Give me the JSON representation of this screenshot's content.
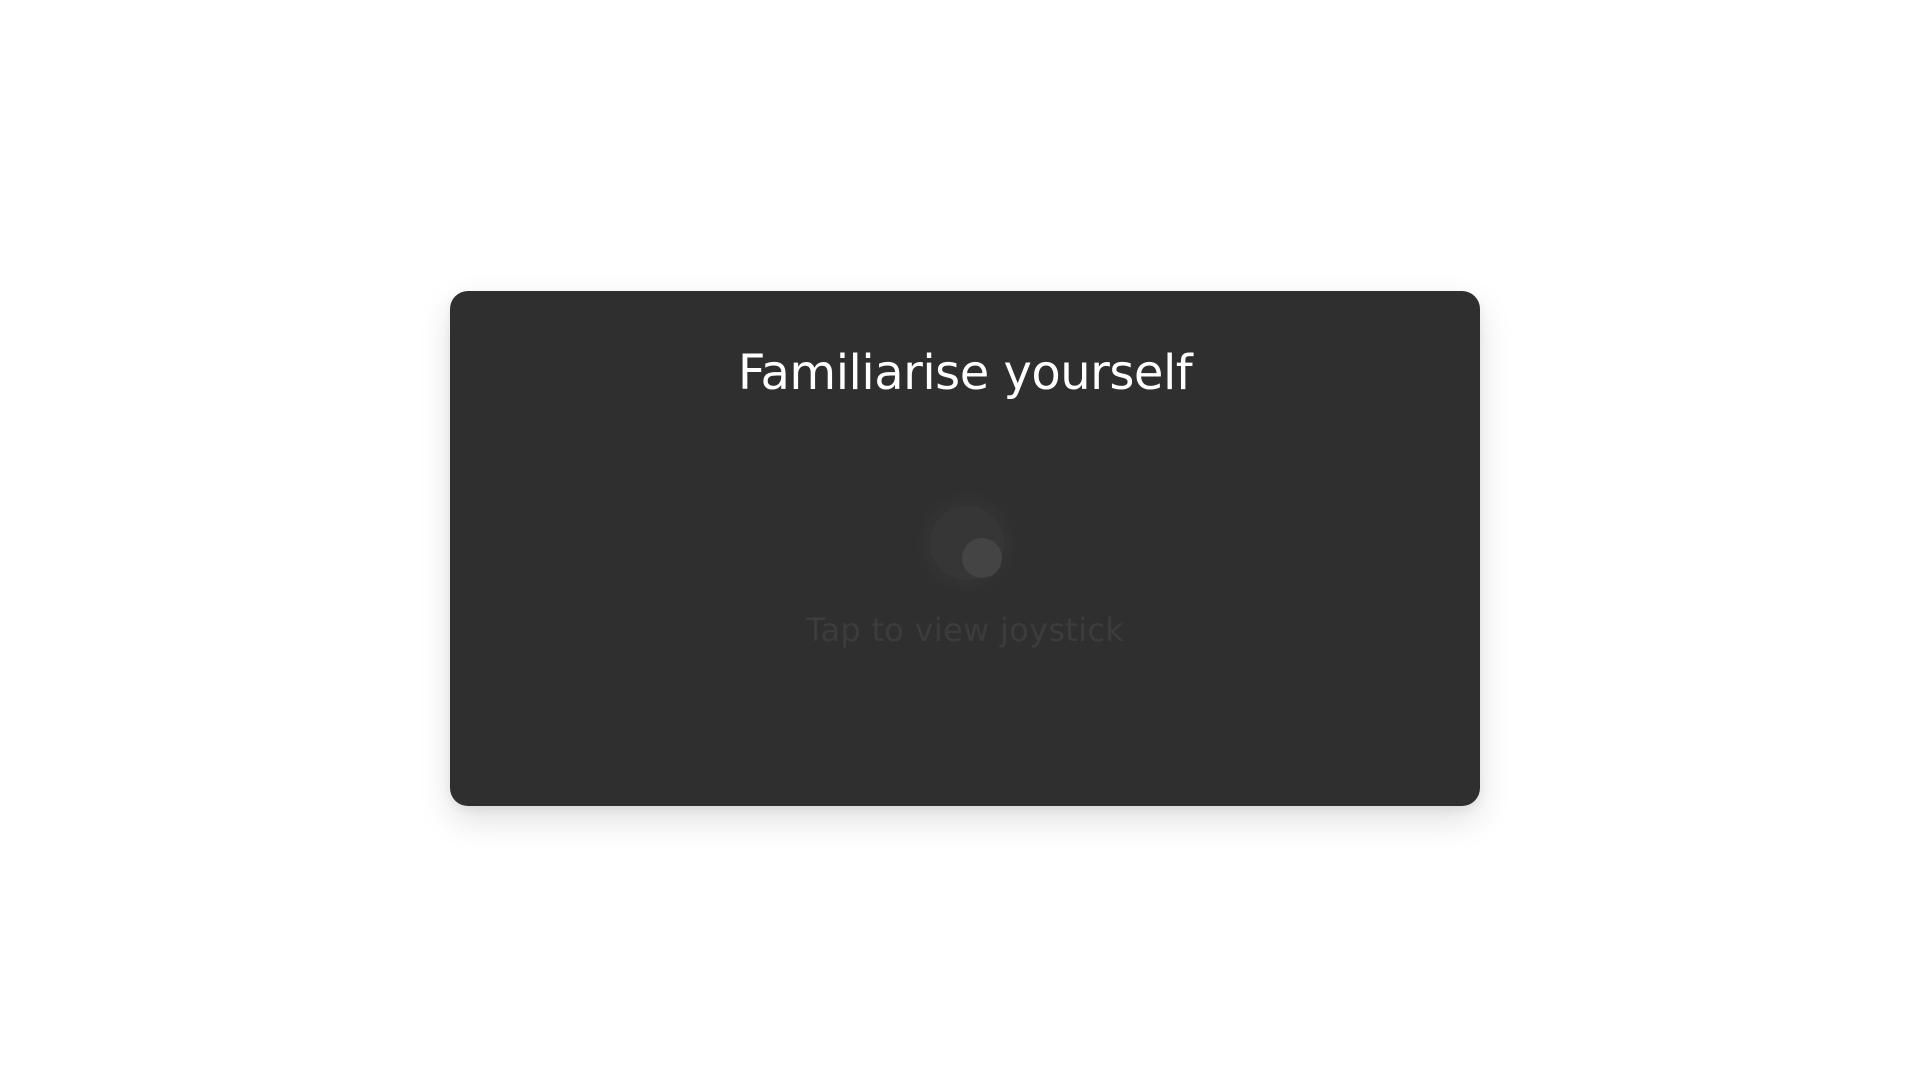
{
  "card": {
    "title": "Familiarise yourself"
  },
  "joystick": {
    "hint": "Tap to view joystick",
    "icon": "joystick-icon"
  },
  "colors": {
    "page_background": "#ffffff",
    "card_background": "#2f2f2f",
    "title_text": "#ffffff",
    "hint_text": "#3c3c3c",
    "joystick_knob": "#444444"
  }
}
